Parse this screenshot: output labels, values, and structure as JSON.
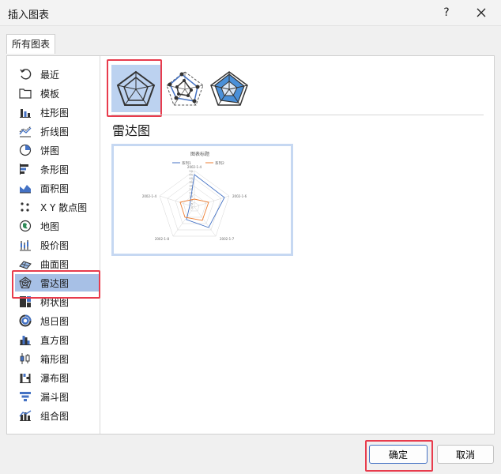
{
  "window": {
    "title": "插入图表",
    "help_label": "?"
  },
  "tabs": [
    {
      "label": "所有图表"
    }
  ],
  "sidebar": {
    "items": [
      {
        "label": "最近",
        "icon": "recent-icon"
      },
      {
        "label": "模板",
        "icon": "folder-icon"
      },
      {
        "label": "柱形图",
        "icon": "column-chart-icon"
      },
      {
        "label": "折线图",
        "icon": "line-chart-icon"
      },
      {
        "label": "饼图",
        "icon": "pie-chart-icon"
      },
      {
        "label": "条形图",
        "icon": "bar-chart-icon"
      },
      {
        "label": "面积图",
        "icon": "area-chart-icon"
      },
      {
        "label": "X Y 散点图",
        "icon": "scatter-chart-icon"
      },
      {
        "label": "地图",
        "icon": "map-chart-icon"
      },
      {
        "label": "股价图",
        "icon": "stock-chart-icon"
      },
      {
        "label": "曲面图",
        "icon": "surface-chart-icon"
      },
      {
        "label": "雷达图",
        "icon": "radar-chart-icon"
      },
      {
        "label": "树状图",
        "icon": "treemap-chart-icon"
      },
      {
        "label": "旭日图",
        "icon": "sunburst-chart-icon"
      },
      {
        "label": "直方图",
        "icon": "histogram-chart-icon"
      },
      {
        "label": "箱形图",
        "icon": "box-chart-icon"
      },
      {
        "label": "瀑布图",
        "icon": "waterfall-chart-icon"
      },
      {
        "label": "漏斗图",
        "icon": "funnel-chart-icon"
      },
      {
        "label": "组合图",
        "icon": "combo-chart-icon"
      }
    ],
    "selected": "雷达图"
  },
  "main": {
    "subtypes": [
      {
        "icon": "radar-icon",
        "selected": true
      },
      {
        "icon": "radar-markers-icon",
        "selected": false
      },
      {
        "icon": "filled-radar-icon",
        "selected": false
      }
    ],
    "section_title": "雷达图",
    "preview": {
      "chart_title": "图表标题",
      "legend": [
        {
          "name": "系列1",
          "color": "#4472c4"
        },
        {
          "name": "系列2",
          "color": "#ed7d31"
        }
      ],
      "axis_labels": [
        "2002-1-4",
        "2002-1-6",
        "2002-1-7",
        "2002-1-8",
        "2002-1-4"
      ],
      "ticks": [
        "50",
        "45",
        "40",
        "35",
        "30",
        "25",
        "20",
        "15",
        "10",
        "5",
        "0"
      ]
    }
  },
  "footer": {
    "ok_label": "确定",
    "cancel_label": "取消"
  },
  "colors": {
    "accent": "#4472c4",
    "selection": "#a7c0e6",
    "highlight_border": "#e83c4d",
    "series2": "#ed7d31"
  }
}
